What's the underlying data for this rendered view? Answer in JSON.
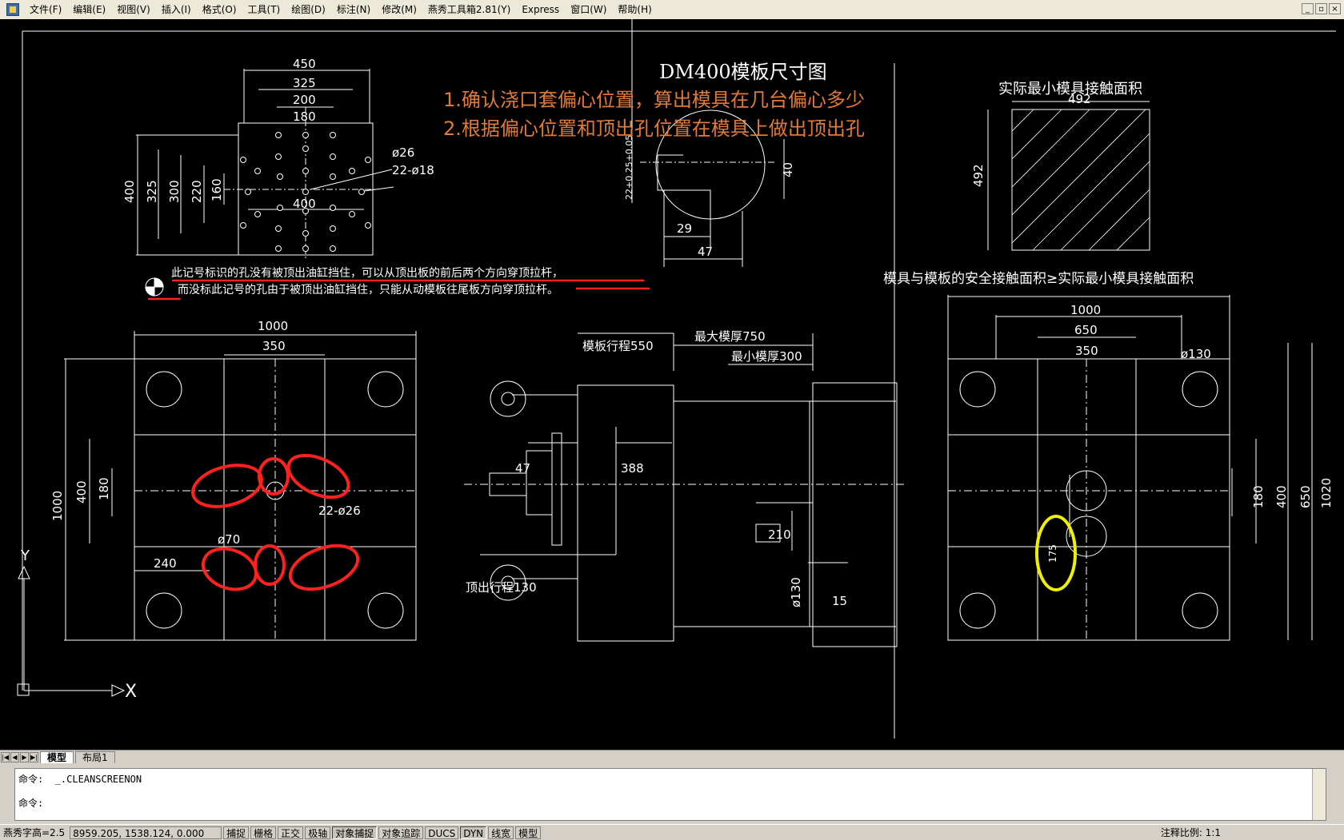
{
  "menubar": {
    "items": [
      "文件(F)",
      "编辑(E)",
      "视图(V)",
      "插入(I)",
      "格式(O)",
      "工具(T)",
      "绘图(D)",
      "标注(N)",
      "修改(M)",
      "燕秀工具箱2.81(Y)",
      "Express",
      "窗口(W)",
      "帮助(H)"
    ],
    "min_label": "_",
    "restore_label": "▫",
    "close_label": "×"
  },
  "drawing": {
    "title": "DM400模板尺寸图",
    "note1": "1.确认浇口套偏心位置，算出模具在几台偏心多少",
    "note2": "2.根据偏心位置和顶出孔位置在模具上做出顶出孔",
    "contact_title": "实际最小模具接触面积",
    "contact_dim_w": "492",
    "contact_dim_h": "492",
    "safety_text": "模具与模板的安全接触面积≥实际最小模具接触面积",
    "legend_line1": "此记号标识的孔没有被顶出油缸挡住，可以从顶出板的前后两个方向穿顶拉杆，",
    "legend_line2": "而没标此记号的孔由于被顶出油缸挡住，只能从动模板往尾板方向穿顶拉杆。",
    "top_dims": {
      "d450": "450",
      "d325": "325",
      "d200": "200",
      "d180": "180",
      "d400h": "400",
      "v400": "400",
      "v325": "325",
      "v300": "300",
      "v220": "220",
      "v160": "160",
      "phi26": "ø26",
      "holes": "22-ø18"
    },
    "nozzle_dims": {
      "tol": "22+0.25+0.05",
      "d40": "40",
      "d29": "29",
      "d47": "47"
    },
    "left_plate": {
      "d1000": "1000",
      "d350": "350",
      "v1000": "1000",
      "v400": "400",
      "v180": "180",
      "d240": "240",
      "phi70": "ø70",
      "holes": "22-ø26"
    },
    "side_view": {
      "stroke": "模板行程550",
      "max_thick": "最大模厚750",
      "min_thick": "最小模厚300",
      "d47": "47",
      "d388": "388",
      "d210": "210",
      "phi130": "ø130",
      "d15": "15",
      "ejector": "顶出行程130"
    },
    "right_plate": {
      "d1000": "1000",
      "d650": "650",
      "d350": "350",
      "phi130": "ø130",
      "v180": "180",
      "v400": "400",
      "v650": "650",
      "v1020": "1020",
      "d175": "175"
    },
    "axis_x": "X",
    "axis_y": "Y"
  },
  "tabs": {
    "model": "模型",
    "layout1": "布局1"
  },
  "command": {
    "line1": "命令:  _.CLEANSCREENON",
    "line2": "命令:"
  },
  "statusbar": {
    "text_height": "燕秀字高=2.5",
    "coords": "8959.205,  1538.124,  0.000",
    "toggles": [
      "捕捉",
      "栅格",
      "正交",
      "极轴",
      "对象捕捉",
      "对象追踪",
      "DUCS",
      "DYN",
      "线宽",
      "模型"
    ],
    "scale": "注释比例:  1:1"
  },
  "colors": {
    "annotation_red": "#ff2020",
    "annotation_yellow": "#f0f000",
    "note_orange": "#e07a3a",
    "cad_line": "#ffffff",
    "background": "#000000"
  }
}
